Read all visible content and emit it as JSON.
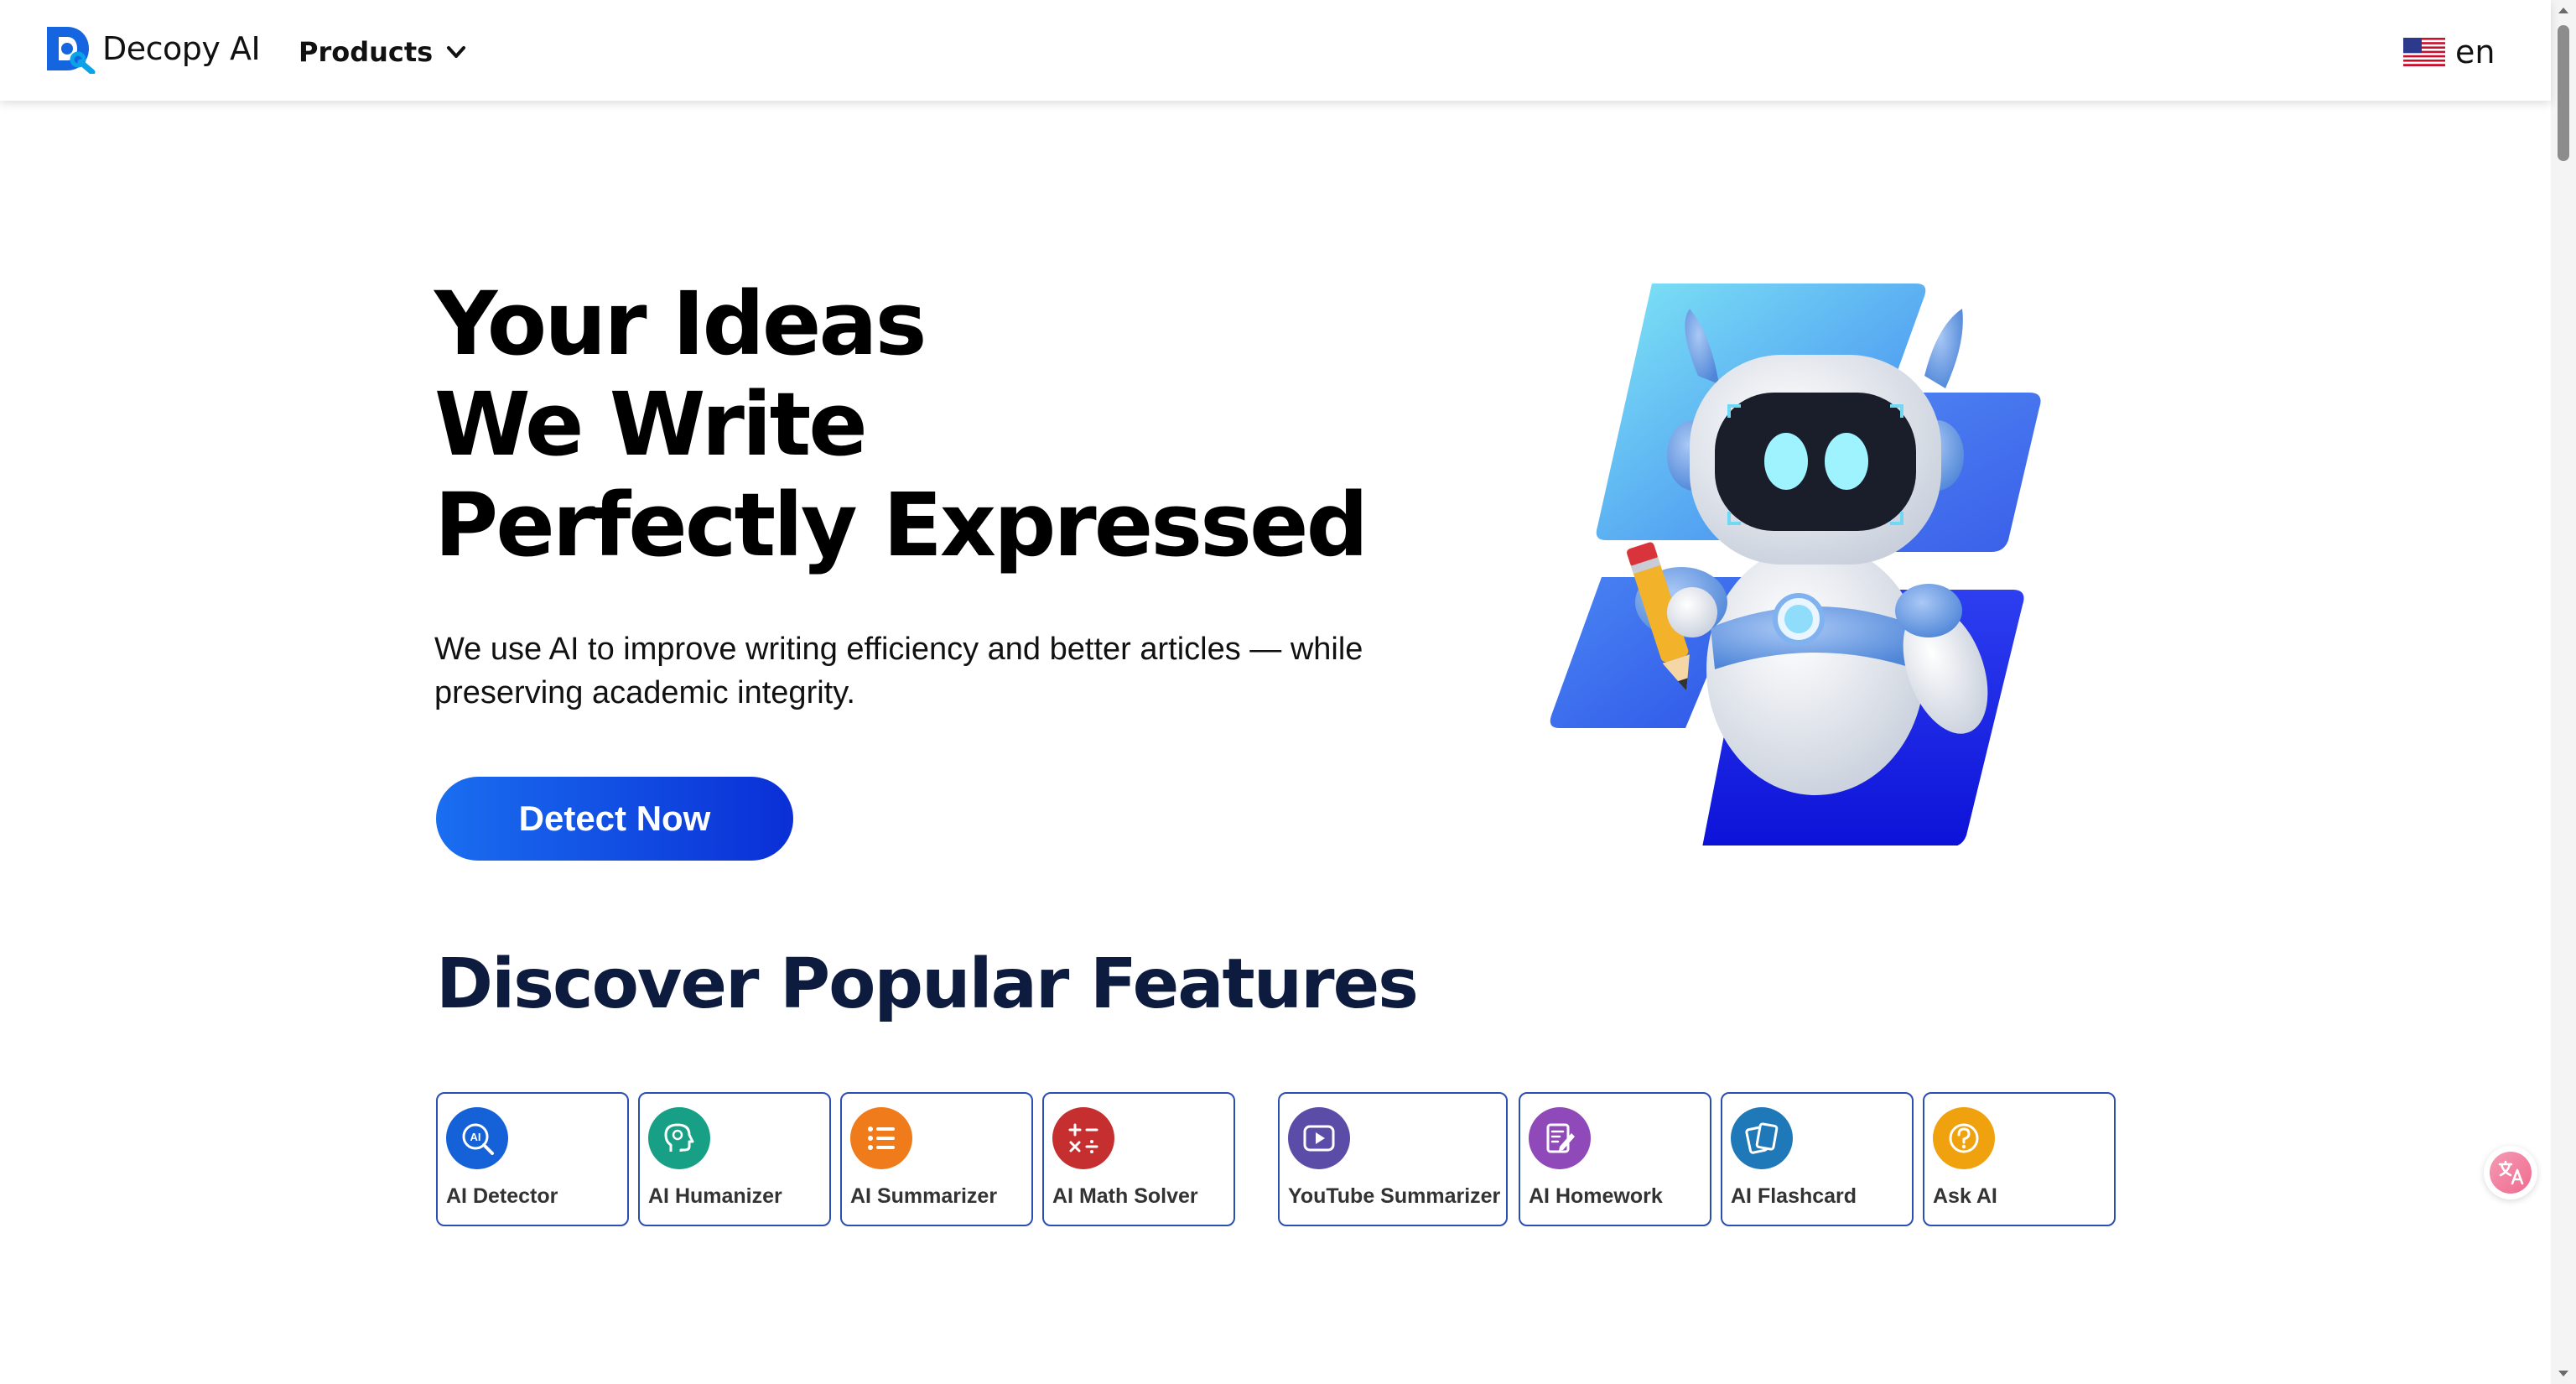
{
  "header": {
    "brand": "Decopy AI",
    "products_label": "Products",
    "language": "en"
  },
  "hero": {
    "title_lines": [
      "Your Ideas",
      "We Write",
      "Perfectly Expressed"
    ],
    "description": "We use AI to improve writing efficiency and better articles — while preserving academic integrity.",
    "cta_label": "Detect Now"
  },
  "features": {
    "heading": "Discover Popular Features",
    "cards": [
      {
        "label": "AI Detector",
        "icon": "ai-detector-icon",
        "color": "#1461d8"
      },
      {
        "label": "AI Humanizer",
        "icon": "humanizer-head-icon",
        "color": "#17a085"
      },
      {
        "label": "AI Summarizer",
        "icon": "list-icon",
        "color": "#ef7b1a"
      },
      {
        "label": "AI Math Solver",
        "icon": "math-symbols-icon",
        "color": "#c62f2f"
      },
      {
        "label": "YouTube Summarizer",
        "icon": "video-play-icon",
        "color": "#5b4ca8"
      },
      {
        "label": "AI Homework",
        "icon": "notebook-pen-icon",
        "color": "#8f49b8"
      },
      {
        "label": "AI Flashcard",
        "icon": "flashcards-icon",
        "color": "#1f78b8"
      },
      {
        "label": "Ask AI",
        "icon": "question-icon",
        "color": "#f0a20e"
      }
    ]
  },
  "colors": {
    "accent": "#1a6ef0",
    "heading_dark": "#0d1b3e",
    "card_border": "#2b4fb0"
  }
}
